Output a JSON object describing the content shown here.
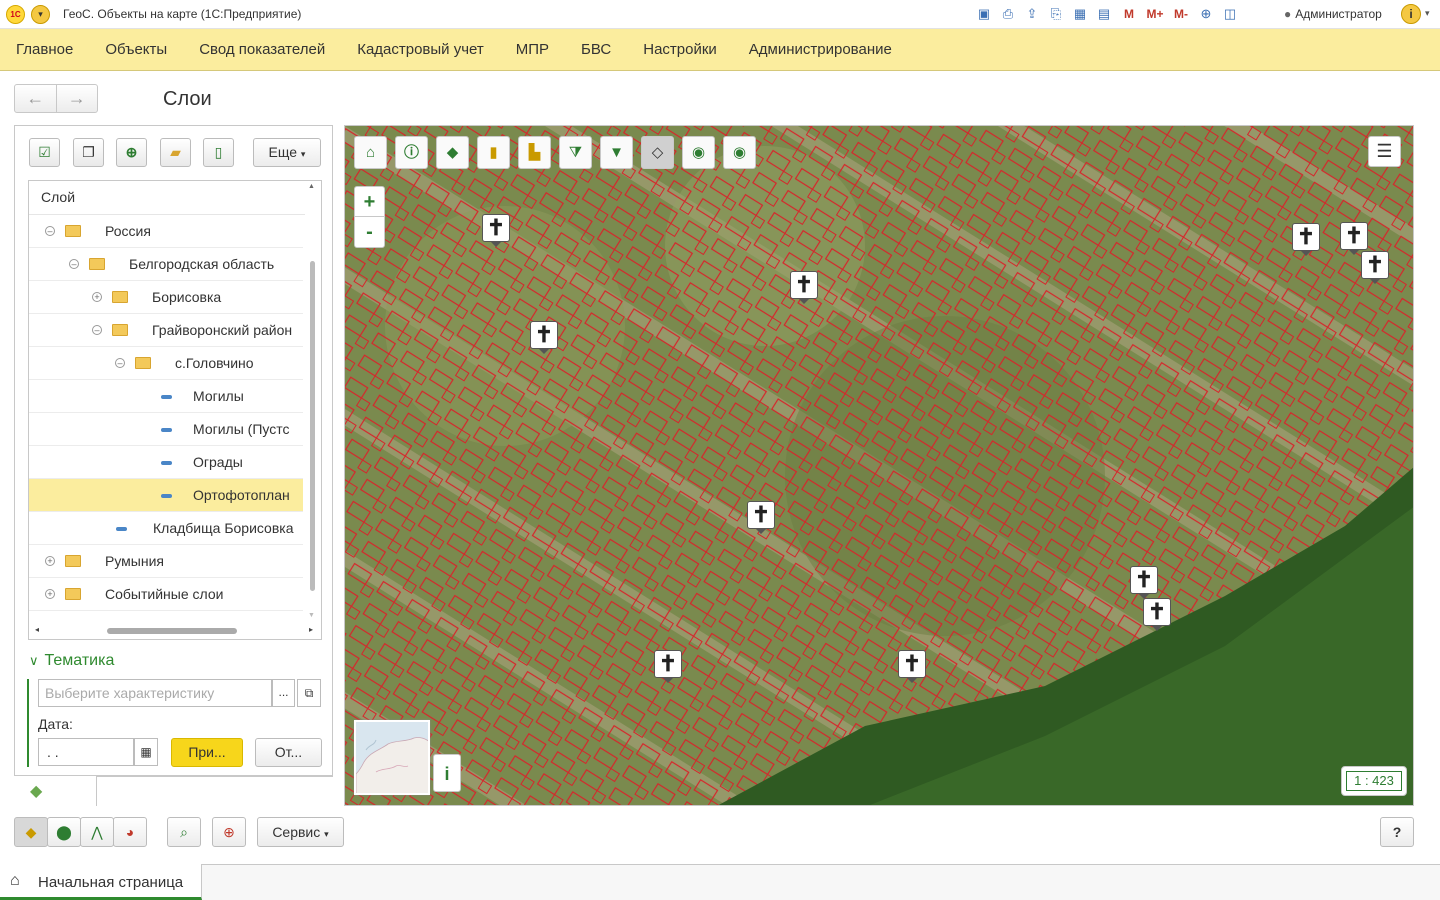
{
  "titlebar": {
    "logo": "1С",
    "app_title": "ГеоС. Объекты на карте  (1С:Предприятие)",
    "toolbar_icons": [
      "save-icon",
      "print-icon",
      "upload-icon",
      "print-preview-icon",
      "calculator-icon",
      "calendar-icon"
    ],
    "memory_buttons": [
      "M",
      "M+",
      "M-"
    ],
    "user": "Администратор",
    "info": "i"
  },
  "menu": {
    "items": [
      "Главное",
      "Объекты",
      "Свод показателей",
      "Кадастровый учет",
      "МПР",
      "БВС",
      "Настройки",
      "Администрирование"
    ]
  },
  "nav": {
    "back": "←",
    "forward": "→",
    "page_title": "Слои"
  },
  "left_panel": {
    "toolbar": {
      "eshche_label": "Еще",
      "buttons": [
        "check-icon",
        "copy-icon",
        "add-icon",
        "add-folder-icon",
        "add-file-icon"
      ]
    },
    "tree": {
      "header": "Слой",
      "rows": [
        {
          "label": "Россия",
          "type": "folder",
          "expand": "⊖",
          "level": 0
        },
        {
          "label": "Белгородская область",
          "type": "folder",
          "expand": "⊖",
          "level": 1
        },
        {
          "label": "Борисовка",
          "type": "folder",
          "expand": "⊕",
          "level": 2
        },
        {
          "label": "Грайворонский район",
          "type": "folder",
          "expand": "⊖",
          "level": 2
        },
        {
          "label": "с.Головчино",
          "type": "folder",
          "expand": "⊖",
          "level": 3
        },
        {
          "label": "Могилы",
          "type": "layer",
          "level": 4
        },
        {
          "label": "Могилы (Пустс",
          "type": "layer",
          "level": 4
        },
        {
          "label": "Ограды",
          "type": "layer",
          "level": 4
        },
        {
          "label": "Ортофотоплан",
          "type": "layer",
          "level": 4,
          "selected": true
        },
        {
          "label": "Кладбища Борисовка",
          "type": "layer",
          "level": 2
        },
        {
          "label": "Румыния",
          "type": "folder",
          "expand": "⊕",
          "level": 0
        },
        {
          "label": "Событийные слои",
          "type": "folder",
          "expand": "⊕",
          "level": 0
        }
      ]
    },
    "tematika": {
      "title": "Тематика",
      "characteristic_placeholder": "Выберите характеристику",
      "dots": "...",
      "date_label": "Дата:",
      "date_value": " .  .",
      "apply_label": "При...",
      "cancel_label": "От..."
    }
  },
  "map": {
    "tools": [
      "home-icon",
      "info-icon",
      "pan-icon",
      "measure-length-icon",
      "measure-area-icon",
      "filter-select-icon",
      "filter-icon",
      "select-polygon-icon",
      "zoom-prev-icon",
      "zoom-next-icon"
    ],
    "zoom_in": "+",
    "zoom_out": "-",
    "scale": "1 : 423",
    "minimap_info": "i",
    "marker_glyph": "✝"
  },
  "bottom_toolbar": {
    "servis_label": "Сервис",
    "help_label": "?"
  },
  "statusbar": {
    "home_tab": "Начальная страница"
  }
}
